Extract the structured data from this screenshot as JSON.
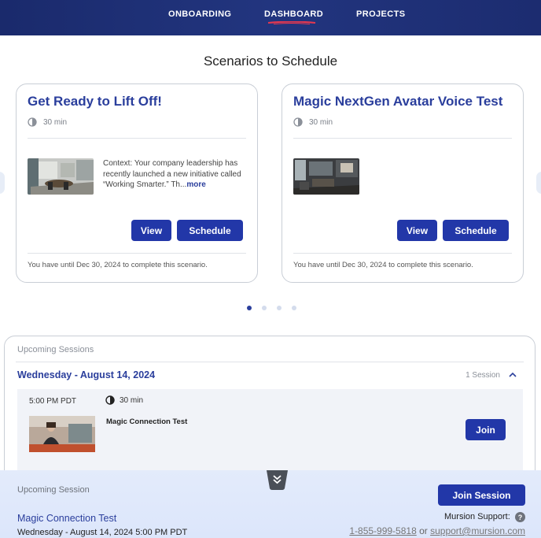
{
  "nav": {
    "items": [
      {
        "label": "ONBOARDING"
      },
      {
        "label": "DASHBOARD",
        "active": true
      },
      {
        "label": "PROJECTS"
      }
    ]
  },
  "scenarios": {
    "title": "Scenarios to Schedule",
    "cards": [
      {
        "title": "Get Ready to Lift Off!",
        "duration": "30 min",
        "context": "Context: Your company leadership has recently launched a new initiative called “Working Smarter.” Th...",
        "more_label": "more",
        "view_label": "View",
        "schedule_label": "Schedule",
        "deadline": "You have until Dec 30, 2024 to complete this scenario."
      },
      {
        "title": "Magic NextGen Avatar Voice Test",
        "duration": "30 min",
        "view_label": "View",
        "schedule_label": "Schedule",
        "deadline": "You have until Dec 30, 2024 to complete this scenario."
      }
    ],
    "carousel": {
      "pages": 4,
      "active_page": 1
    }
  },
  "upcoming": {
    "heading": "Upcoming Sessions",
    "date": "Wednesday - August 14, 2024",
    "count": "1 Session",
    "session": {
      "time": "5:00 PM PDT",
      "duration": "30 min",
      "name": "Magic Connection Test",
      "join_label": "Join"
    }
  },
  "bottom_bar": {
    "label": "Upcoming Session",
    "session_name": "Magic Connection Test",
    "datetime": "Wednesday - August 14, 2024 5:00 PM PDT",
    "join_label": "Join Session",
    "support_label": "Mursion Support:",
    "help_icon": "?",
    "phone": "1-855-999-5818",
    "or_text": "or",
    "email": "support@mursion.com"
  },
  "colors": {
    "nav_bg": "#1d2d72",
    "accent": "#2237a8",
    "title_blue": "#2a3e9c",
    "nav_underline": "#e8384f"
  }
}
